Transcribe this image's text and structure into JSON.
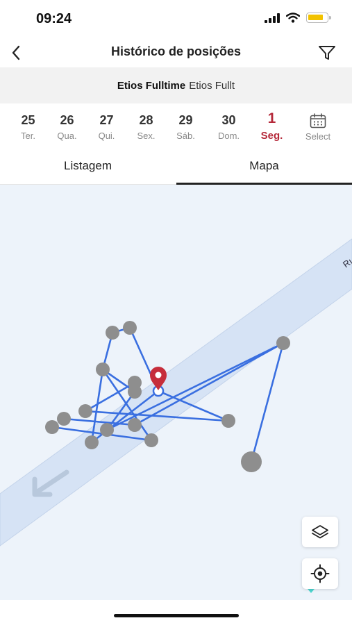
{
  "status_bar": {
    "time": "09:24",
    "battery_color": "#f2c200",
    "battery_level": 0.85
  },
  "header": {
    "title": "Histórico de posições",
    "back_icon": "chevron-left-icon",
    "filter_icon": "funnel-icon"
  },
  "vehicle": {
    "name": "Etios Fulltime",
    "model": "Etios Fullt"
  },
  "dates": [
    {
      "num": "25",
      "day": "Ter."
    },
    {
      "num": "26",
      "day": "Qua."
    },
    {
      "num": "27",
      "day": "Qui."
    },
    {
      "num": "28",
      "day": "Sex."
    },
    {
      "num": "29",
      "day": "Sáb."
    },
    {
      "num": "30",
      "day": "Dom."
    },
    {
      "num": "1",
      "day": "Seg."
    }
  ],
  "select_label": "Select",
  "selected_color": "#b5293a",
  "tabs": [
    {
      "label": "Listagem"
    },
    {
      "label": "Mapa"
    }
  ],
  "active_tab": "Mapa",
  "map": {
    "road_label": "Rı",
    "route_color": "#3a6fe0",
    "point_color": "#8e8e8e",
    "marker_color": "#c62d3b",
    "road_color": "#d6e3f5",
    "layers_icon": "layers-icon",
    "locate_icon": "crosshair-icon"
  }
}
